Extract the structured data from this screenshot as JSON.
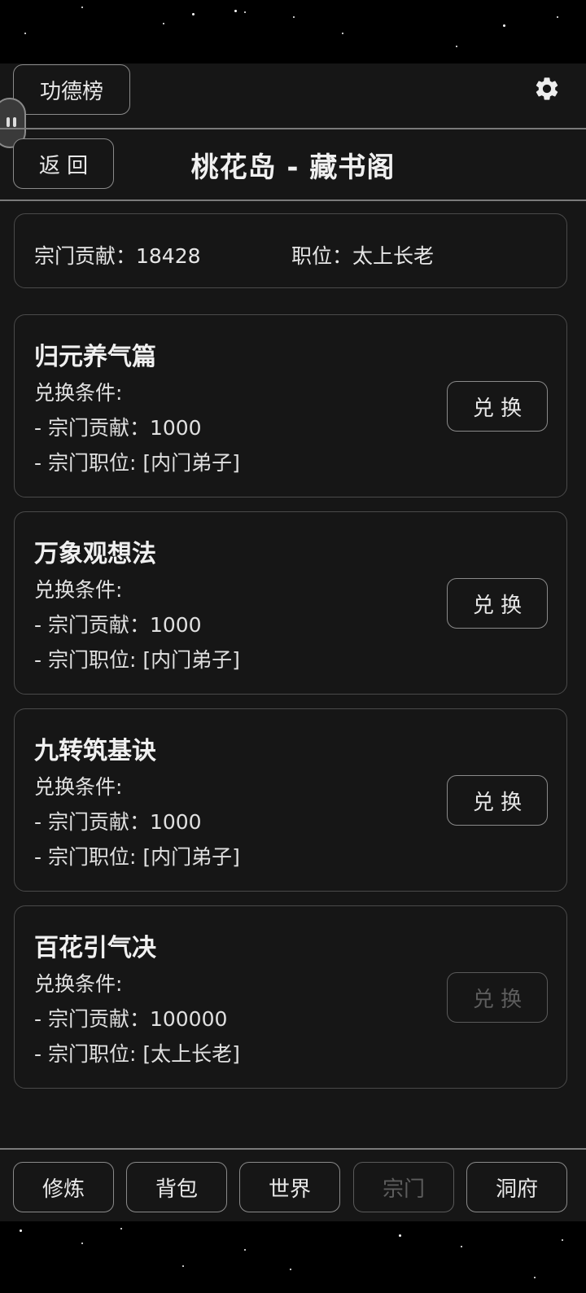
{
  "header": {
    "leaderboard_label": "功德榜",
    "back_label": "返 回",
    "title": "桃花岛 - 藏书阁"
  },
  "info": {
    "contribution_label": "宗门贡献：18428",
    "position_label": "职位：太上长老"
  },
  "items": [
    {
      "name": "归元养气篇",
      "cond_title": "兑换条件:",
      "cond_contribution": "- 宗门贡献：1000",
      "cond_position": "- 宗门职位: [内门弟子]",
      "button": "兑 换",
      "enabled": true
    },
    {
      "name": "万象观想法",
      "cond_title": "兑换条件:",
      "cond_contribution": "- 宗门贡献：1000",
      "cond_position": "- 宗门职位: [内门弟子]",
      "button": "兑 换",
      "enabled": true
    },
    {
      "name": "九转筑基诀",
      "cond_title": "兑换条件:",
      "cond_contribution": "- 宗门贡献：1000",
      "cond_position": "- 宗门职位: [内门弟子]",
      "button": "兑 换",
      "enabled": true
    },
    {
      "name": "百花引气决",
      "cond_title": "兑换条件:",
      "cond_contribution": "- 宗门贡献：100000",
      "cond_position": "- 宗门职位: [太上长老]",
      "button": "兑 换",
      "enabled": false
    }
  ],
  "nav": [
    {
      "label": "修炼",
      "enabled": true
    },
    {
      "label": "背包",
      "enabled": true
    },
    {
      "label": "世界",
      "enabled": true
    },
    {
      "label": "宗门",
      "enabled": false
    },
    {
      "label": "洞府",
      "enabled": true
    }
  ],
  "icons": {
    "settings": "gear-icon",
    "floating": "floating-assist-icon"
  }
}
